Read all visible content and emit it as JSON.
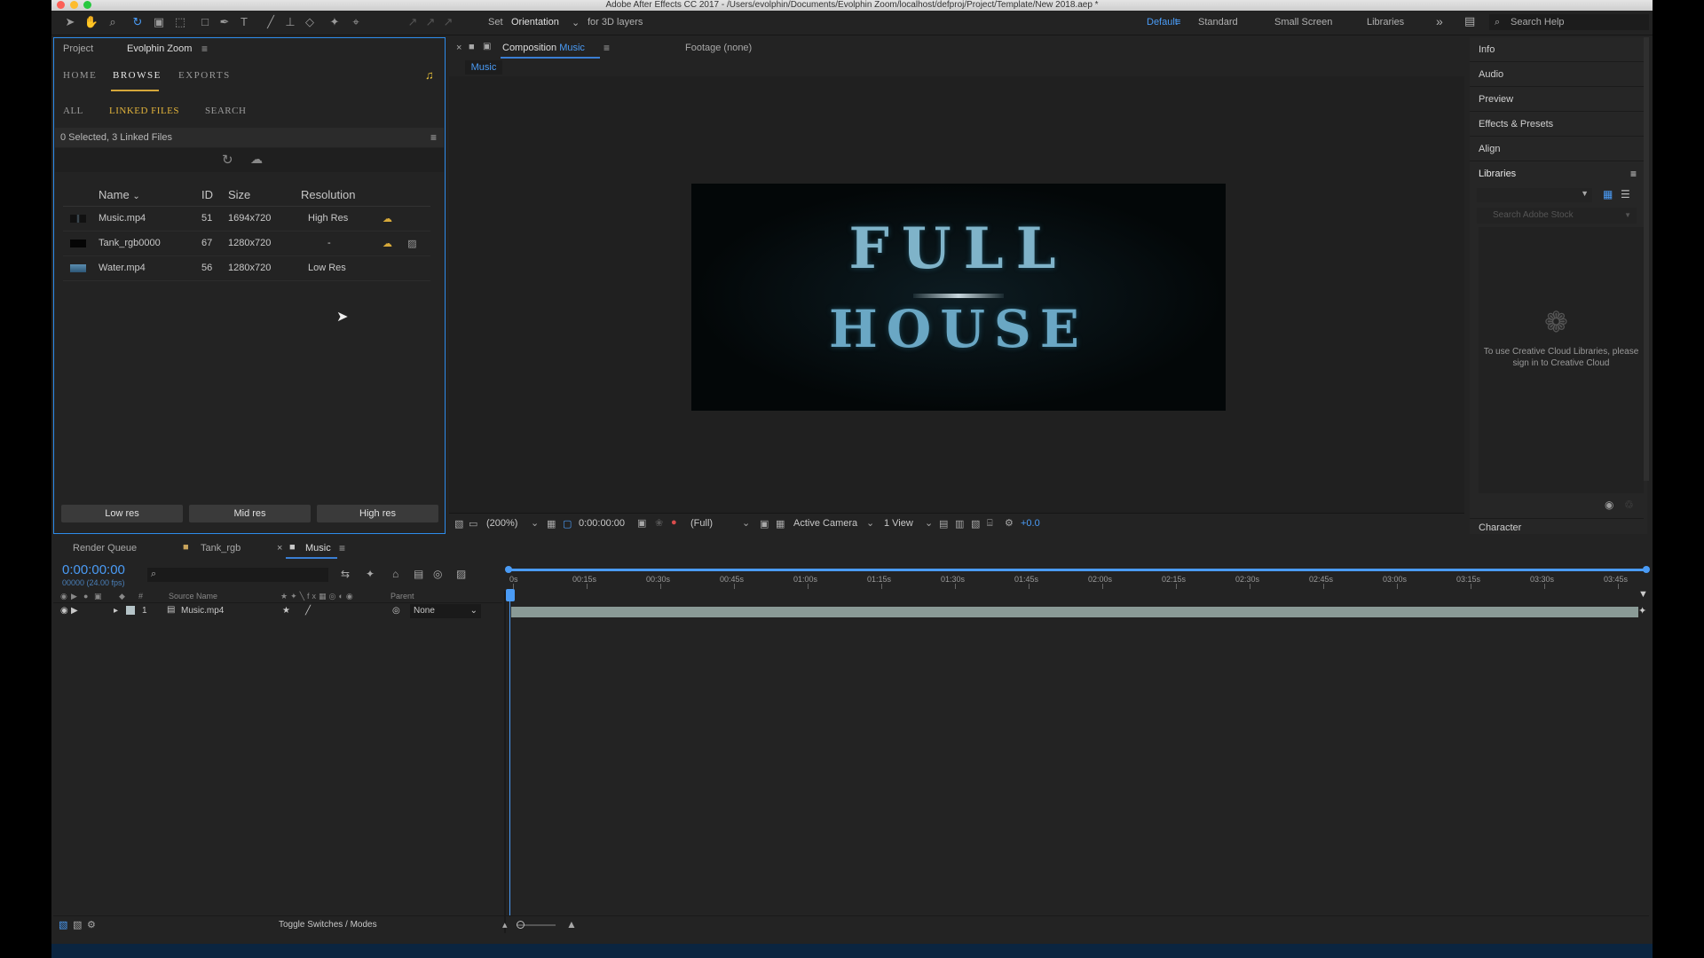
{
  "title": "Adobe After Effects CC 2017 - /Users/evolphin/Documents/Evolphin Zoom/localhost/defproj/Project/Template/New 2018.aep *",
  "toolbar": {
    "set_label": "Set",
    "orientation_label": "Orientation",
    "for3d_label": "for 3D layers",
    "workspaces": [
      "Default",
      "Standard",
      "Small Screen",
      "Libraries"
    ],
    "search_help": "Search Help"
  },
  "project_panel": {
    "tabs": [
      "Project",
      "Evolphin Zoom"
    ],
    "nav": [
      "HOME",
      "BROWSE",
      "EXPORTS"
    ],
    "subnav": [
      "ALL",
      "LINKED FILES",
      "SEARCH"
    ],
    "status": "0 Selected, 3 Linked Files",
    "columns": [
      "Name",
      "ID",
      "Size",
      "Resolution"
    ],
    "files": [
      {
        "name": "Music.mp4",
        "id": "51",
        "size": "1694x720",
        "resolution": "High Res"
      },
      {
        "name": "Tank_rgb0000",
        "id": "67",
        "size": "1280x720",
        "resolution": "-"
      },
      {
        "name": "Water.mp4",
        "id": "56",
        "size": "1280x720",
        "resolution": "Low Res"
      }
    ],
    "buttons": [
      "Low res",
      "Mid res",
      "High res"
    ]
  },
  "composition": {
    "tab_prefix": "Composition",
    "tab_name": "Music",
    "footage_tab": "Footage (none)",
    "sub_tab": "Music",
    "title_line1": "FULL",
    "title_line2": "HOUSE",
    "zoom": "(200%)",
    "timecode": "0:00:00:00",
    "quality": "(Full)",
    "camera": "Active Camera",
    "views": "1 View",
    "exposure": "+0.0"
  },
  "right_panel": {
    "items": [
      "Info",
      "Audio",
      "Preview",
      "Effects & Presets",
      "Align",
      "Libraries"
    ],
    "search_placeholder": "Search Adobe Stock",
    "message": "To use Creative Cloud Libraries, please sign in to Creative Cloud",
    "character": "Character"
  },
  "timeline": {
    "tabs": [
      "Render Queue",
      "Tank_rgb",
      "Music"
    ],
    "timecode": "0:00:00:00",
    "fps": "00000 (24.00 fps)",
    "col_source": "Source Name",
    "col_parent": "Parent",
    "layer_num": "1",
    "layer_name": "Music.mp4",
    "parent_value": "None",
    "ruler": [
      "0s",
      "00:15s",
      "00:30s",
      "00:45s",
      "01:00s",
      "01:15s",
      "01:30s",
      "01:45s",
      "02:00s",
      "02:15s",
      "02:30s",
      "02:45s",
      "03:00s",
      "03:15s",
      "03:30s",
      "03:45s"
    ],
    "toggle_label": "Toggle Switches / Modes"
  }
}
